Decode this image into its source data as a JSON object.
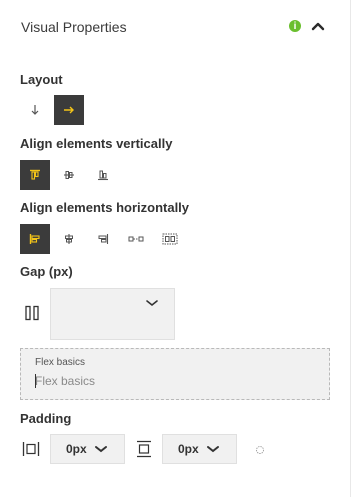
{
  "panel": {
    "title": "Visual Properties",
    "info_icon": "info-circle-icon",
    "collapse_icon": "chevron-up-icon",
    "accent_color": "#3b3b3b",
    "highlight_color": "#f5c518",
    "info_color": "#6abf2e"
  },
  "layout": {
    "label": "Layout",
    "options": [
      {
        "name": "layout-vertical-button",
        "icon": "arrow-down-icon",
        "active": false
      },
      {
        "name": "layout-horizontal-button",
        "icon": "arrow-right-icon",
        "active": true
      }
    ]
  },
  "align_vertical": {
    "label": "Align elements vertically",
    "options": [
      {
        "icon": "align-top-icon",
        "active": true
      },
      {
        "icon": "align-middle-icon",
        "active": false
      },
      {
        "icon": "align-bottom-icon",
        "active": false
      }
    ]
  },
  "align_horizontal": {
    "label": "Align elements horizontally",
    "options": [
      {
        "icon": "align-left-icon",
        "active": true
      },
      {
        "icon": "align-center-icon",
        "active": false
      },
      {
        "icon": "align-right-icon",
        "active": false
      },
      {
        "icon": "space-between-icon",
        "active": false
      },
      {
        "icon": "space-around-icon",
        "active": false
      }
    ]
  },
  "gap": {
    "label": "Gap (px)",
    "icon": "gap-columns-icon",
    "value": ""
  },
  "flex_basics": {
    "label": "Flex basics",
    "placeholder": "Flex basics",
    "value": ""
  },
  "padding": {
    "label": "Padding",
    "horizontal": {
      "icon": "padding-horizontal-icon",
      "value": "0px"
    },
    "vertical": {
      "icon": "padding-vertical-icon",
      "value": "0px"
    },
    "link_icon": "link-toggle-icon"
  }
}
